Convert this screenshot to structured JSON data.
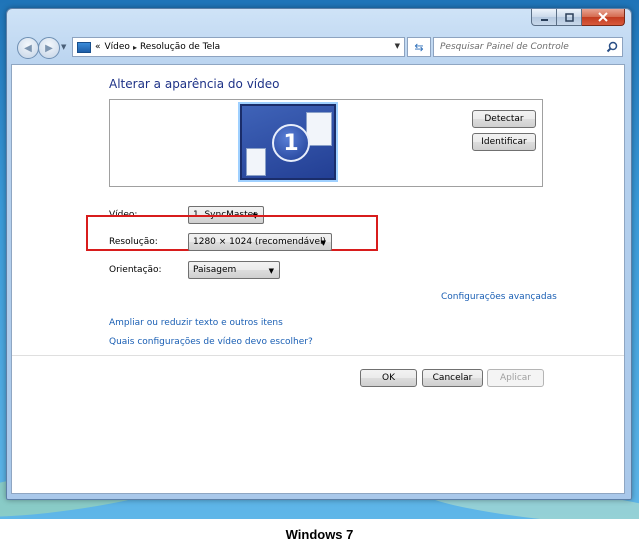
{
  "window": {
    "caption_buttons": [
      "minimize",
      "maximize",
      "close"
    ]
  },
  "nav": {
    "breadcrumb_prefix": "«",
    "breadcrumb_1": "Vídeo",
    "breadcrumb_sep": "▸",
    "breadcrumb_2": "Resolução de Tela",
    "search_placeholder": "Pesquisar Painel de Controle"
  },
  "main": {
    "title": "Alterar a aparência do vídeo",
    "monitor_number": "1",
    "detect_label": "Detectar",
    "identify_label": "Identificar",
    "video_label": "Vídeo:",
    "video_value": "1. SyncMaster",
    "resolution_label": "Resolução:",
    "resolution_value": "1280 × 1024 (recomendável)",
    "orientation_label": "Orientação:",
    "orientation_value": "Paisagem",
    "advanced_link": "Configurações avançadas",
    "link_1": "Ampliar ou reduzir texto e outros itens",
    "link_2": "Quais configurações de vídeo devo escolher?"
  },
  "footer_buttons": {
    "ok": "OK",
    "cancel": "Cancelar",
    "apply": "Aplicar"
  },
  "caption": "Windows 7",
  "colors": {
    "title": "#1e3287",
    "link": "#1a5fb4",
    "highlight_border": "#d81c1c",
    "desktop": "#3a9ad8"
  }
}
